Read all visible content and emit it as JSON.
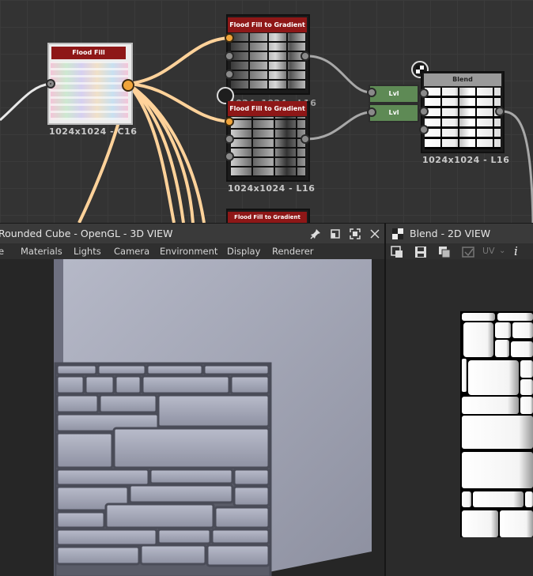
{
  "graph": {
    "flood_fill": {
      "title": "Flood Fill",
      "resolution": "1024x1024 - C16"
    },
    "gradient_node_1": {
      "title": "Flood Fill to Gradient",
      "resolution": "1024x1024 - L16"
    },
    "gradient_node_2": {
      "title": "Flood Fill to Gradient",
      "resolution": "1024x1024 - L16"
    },
    "gradient_node_3": {
      "title": "Flood Fill to Gradient"
    },
    "levels_1": {
      "label": "Lvl"
    },
    "levels_2": {
      "label": "Lvl"
    },
    "blend": {
      "title": "Blend",
      "resolution": "1024x1024 - L16"
    }
  },
  "view3d": {
    "title": "Rounded Cube - OpenGL - 3D VIEW",
    "menu": [
      "e",
      "Materials",
      "Lights",
      "Camera",
      "Environment",
      "Display",
      "Renderer"
    ]
  },
  "view2d": {
    "title": "Blend - 2D VIEW",
    "uv_label": "UV"
  },
  "colors": {
    "graph_bg": "#333333",
    "gradient_title": "#8e1717",
    "connected_port": "#f0a43a",
    "levels_node": "#5e8a55",
    "uv_wire": "#ffd29a"
  },
  "icons": [
    "pin-icon",
    "float-icon",
    "maximize-icon",
    "close-icon",
    "checker-icon",
    "export-icon",
    "save-icon",
    "copy-icon",
    "uv-icon",
    "info-icon"
  ]
}
